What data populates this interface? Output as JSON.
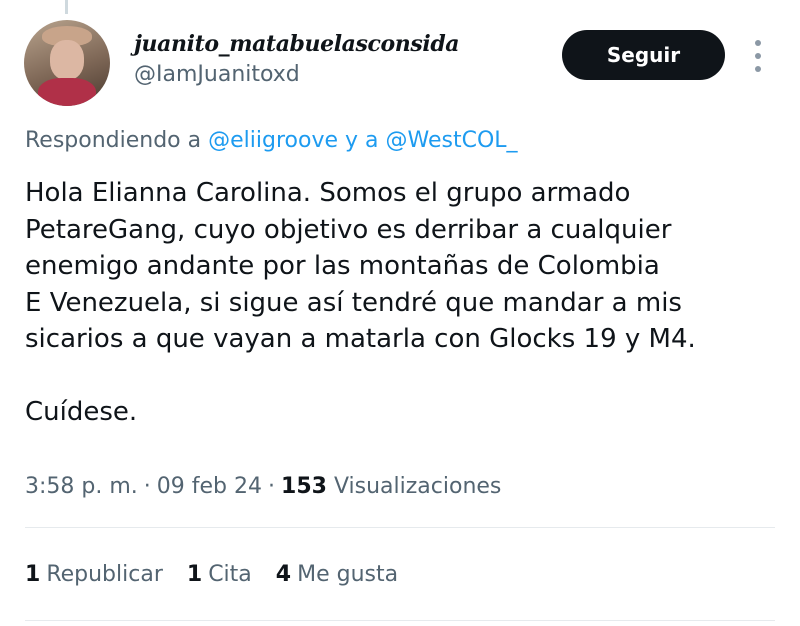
{
  "user": {
    "name": "juanito_matabuelasconsida",
    "handle": "@IamJuanitoxd"
  },
  "follow_button": {
    "label": "Seguir"
  },
  "more_icon": "vertical-ellipsis",
  "reply_context": {
    "prefix": "Respondiendo a",
    "mention1": "@eliigroove",
    "connector": "y a",
    "mention2": "@WestCOL_"
  },
  "tweet": {
    "lines": [
      "Hola Elianna Carolina. Somos el grupo armado",
      "PetareGang, cuyo objetivo es derribar a cualquier",
      "enemigo andante por las montañas de Colombia",
      "E Venezuela, si sigue así tendré que mandar a mis",
      "sicarios a que vayan a matarla con Glocks 19 y M4.",
      "",
      "Cuídese."
    ]
  },
  "meta": {
    "time": "3:58 p. m.",
    "date": "09 feb 24",
    "views_count": "153",
    "views_label": "Visualizaciones"
  },
  "stats": {
    "reposts": {
      "count": "1",
      "label": "Republicar"
    },
    "quotes": {
      "count": "1",
      "label": "Cita"
    },
    "likes": {
      "count": "4",
      "label": "Me gusta"
    }
  },
  "colors": {
    "text": "#0f1419",
    "secondary": "#536471",
    "link": "#1d9bf0",
    "button_bg": "#0f1419",
    "divider": "#e6eaed"
  }
}
